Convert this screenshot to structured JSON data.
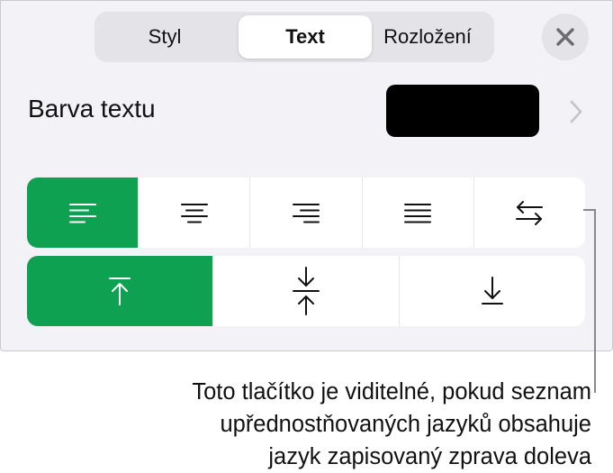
{
  "tabs": [
    {
      "label": "Styl",
      "active": false
    },
    {
      "label": "Text",
      "active": true
    },
    {
      "label": "Rozložení",
      "active": false
    }
  ],
  "text_color_row": {
    "label": "Barva textu",
    "swatch_color": "#000000"
  },
  "horizontal_alignment": {
    "selected": "align-left",
    "buttons": [
      "align-left-icon",
      "align-center-icon",
      "align-right-icon",
      "justify-icon",
      "text-direction-icon"
    ]
  },
  "vertical_alignment": {
    "selected": "align-top",
    "buttons": [
      "align-top-icon",
      "align-middle-icon",
      "align-bottom-icon"
    ]
  },
  "accent_color": "#0ea152",
  "callout": {
    "line1": "Toto tlačítko je viditelné, pokud seznam",
    "line2": "upřednostňovaných jazyků obsahuje",
    "line3": "jazyk zapisovaný zprava doleva"
  }
}
